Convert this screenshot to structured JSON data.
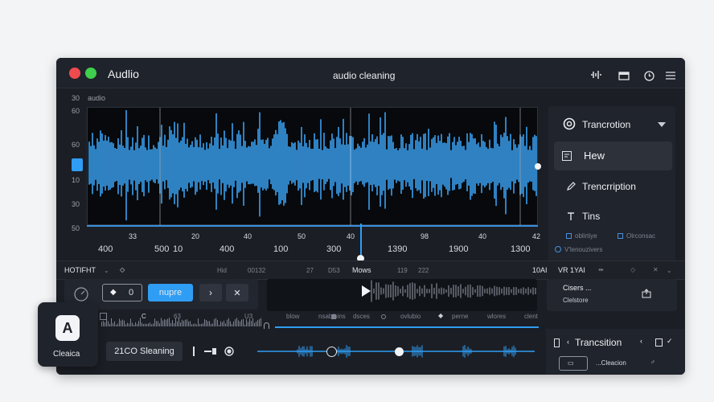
{
  "window": {
    "app_title": "Audlio",
    "center_title": "audio cleaning"
  },
  "toolbar_icons": [
    "waveform-icon",
    "window-icon",
    "clock-icon",
    "menu-icon"
  ],
  "waveform": {
    "top_left": [
      "30",
      "audio"
    ],
    "y_labels": [
      "60",
      "60",
      "10",
      "30",
      "50"
    ],
    "x_top_ticks": [
      "33",
      "20",
      "40",
      "50",
      "40",
      "98",
      "40",
      "42"
    ],
    "x_bottom_ticks": [
      "400",
      "500",
      "10",
      "400",
      "100",
      "300",
      "1390",
      "1900",
      "1300"
    ]
  },
  "right_panel": {
    "header": "Trancrotion",
    "items": [
      {
        "label": "Hew",
        "icon": "grid-icon",
        "selected": true
      },
      {
        "label": "Trencrription",
        "icon": "pen-icon",
        "selected": false
      },
      {
        "label": "Tins",
        "icon": "text-icon",
        "selected": false
      }
    ],
    "checks": [
      "oblirtiye",
      "Olrconsac"
    ],
    "footnote": "V'lenouzivers"
  },
  "bar1": {
    "left": "HOTIFHT",
    "hint": "Hid",
    "n1": "00132",
    "n2": "27",
    "n3": "D53",
    "center": "Mows",
    "n4": "119",
    "n5": "222",
    "right": "10AI",
    "right2": "VR 1YAI"
  },
  "controls": {
    "counter": "0",
    "primary": "nupre",
    "right_title": "Cisers ...",
    "right_sub": "Clelstore"
  },
  "mini_labels": [
    "blow",
    "nsabihins",
    "dsces",
    "ovlubio",
    "perne",
    "wlores",
    "clent"
  ],
  "mini_small": [
    "C",
    "63",
    "U3"
  ],
  "bottom": {
    "left_label": "21CO Sleaning",
    "right_header": "Trancsition",
    "right_item": "...Cleacion"
  },
  "app_card": {
    "letter": "A",
    "label": "Cleaica"
  },
  "colors": {
    "accent": "#2f9df4",
    "wave": "#3aa0f0",
    "dot_red": "#ee4b4f",
    "dot_green": "#3fcf4d"
  }
}
